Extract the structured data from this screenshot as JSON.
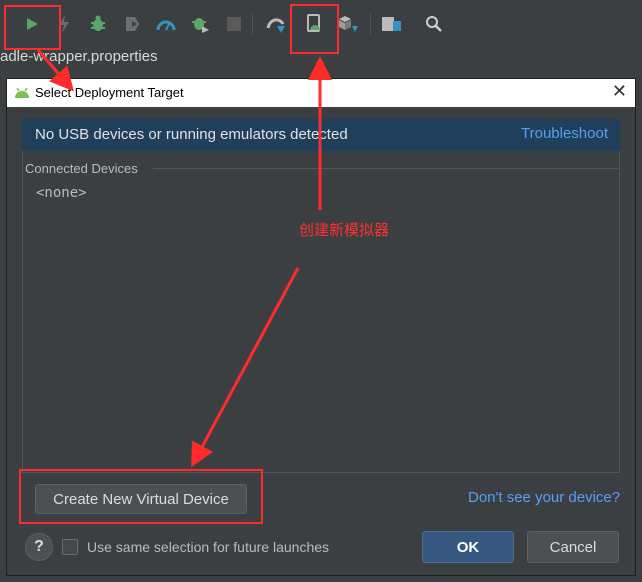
{
  "toolbar": {
    "icons": [
      "run-icon",
      "lightning-icon",
      "debug-icon",
      "coverage-icon",
      "profile-icon",
      "attach-debugger-icon",
      "stop-icon",
      "gradle-sync-icon",
      "avd-manager-icon",
      "sdk-manager-icon",
      "project-structure-icon",
      "search-icon"
    ]
  },
  "editor": {
    "tab_title": "adle-wrapper.properties"
  },
  "dialog": {
    "title": "Select Deployment Target",
    "banner_message": "No USB devices or running emulators detected",
    "troubleshoot_link": "Troubleshoot",
    "section_title": "Connected Devices",
    "none_item": "<none>",
    "create_button": "Create New Virtual Device",
    "dont_see_link": "Don't see your device?",
    "help_label": "?",
    "checkbox_label": "Use same selection for future launches",
    "checkbox_checked": false,
    "ok_button": "OK",
    "cancel_button": "Cancel"
  },
  "annotation": {
    "label": "创建新模拟器",
    "color": "#ff2b2b"
  },
  "colors": {
    "ide_bg": "#3c3f41",
    "banner_bg": "#1f3f5b",
    "link": "#589df6",
    "ok_button": "#365880",
    "run_green": "#59a869"
  }
}
